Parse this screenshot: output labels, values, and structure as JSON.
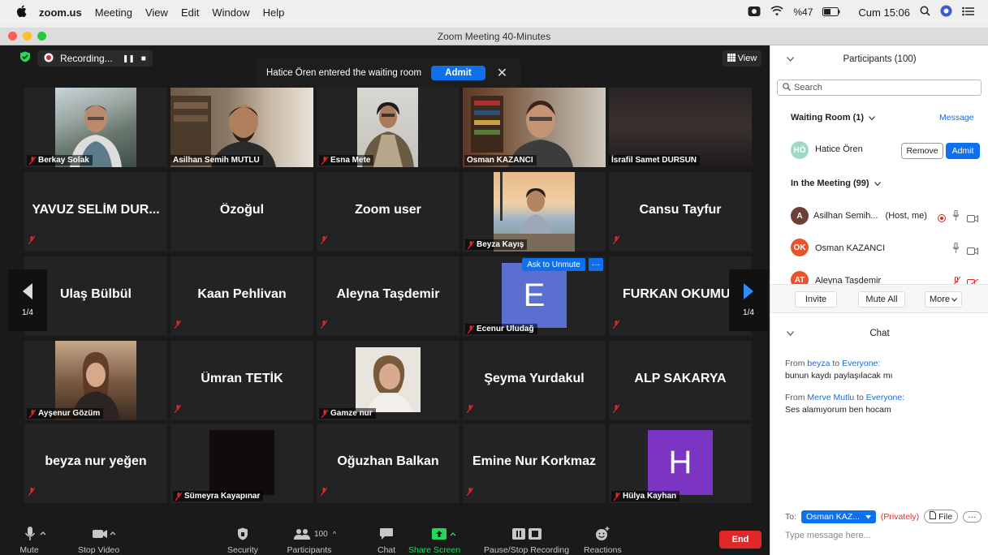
{
  "menubar": {
    "app": "zoom.us",
    "items": [
      "Meeting",
      "View",
      "Edit",
      "Window",
      "Help"
    ],
    "battery": "%47",
    "clock": "Cum 15:06"
  },
  "window": {
    "title": "Zoom Meeting  40-Minutes"
  },
  "recording": {
    "label": "Recording...",
    "pause": "❚❚",
    "stop": "■"
  },
  "view_button": {
    "label": "View"
  },
  "notification": {
    "text": "Hatice Ören entered the waiting room",
    "admit": "Admit",
    "close": "✕"
  },
  "tiles": {
    "t0": {
      "name": "Berkay Solak"
    },
    "t1": {
      "name": "Asilhan Semih MUTLU"
    },
    "t2": {
      "name": "Esna Mete"
    },
    "t3": {
      "name": "Osman KAZANCI"
    },
    "t4": {
      "name": "İsrafil Samet DURSUN"
    },
    "t5": {
      "name": "YAVUZ SELİM DUR..."
    },
    "t6": {
      "name": "Özoğul"
    },
    "t7": {
      "name": "Zoom user"
    },
    "t8": {
      "name": "Beyza Kayış"
    },
    "t9": {
      "name": "Cansu Tayfur"
    },
    "t10": {
      "name": "Ulaş Bülbül"
    },
    "t11": {
      "name": "Kaan Pehlivan"
    },
    "t12": {
      "name": "Aleyna Taşdemir"
    },
    "t13": {
      "name": "Ecenur Uludağ",
      "initial": "E"
    },
    "t14": {
      "name": "FURKAN OKUMUŞ"
    },
    "t15": {
      "name": "Ayşenur Gözüm"
    },
    "t16": {
      "name": "Ümran TETİK"
    },
    "t17": {
      "name": "Gamze nur"
    },
    "t18": {
      "name": "Şeyma Yurdakul"
    },
    "t19": {
      "name": "ALP SAKARYA"
    },
    "t20": {
      "name": "beyza nur yeğen"
    },
    "t21": {
      "name": "Sümeyra Kayapınar"
    },
    "t22": {
      "name": "Oğuzhan Balkan"
    },
    "t23": {
      "name": "Emine Nur Korkmaz"
    },
    "t24": {
      "name": "Hülya Kayhan",
      "initial": "H"
    }
  },
  "ask_unmute": {
    "label": "Ask to Unmute",
    "more": "···"
  },
  "page_nav": {
    "left": "1/4",
    "right": "1/4"
  },
  "toolbar": {
    "mute": "Mute",
    "stop_video": "Stop Video",
    "security": "Security",
    "participants": "Participants",
    "participants_count": "100",
    "chat": "Chat",
    "share_screen": "Share Screen",
    "pause_recording": "Pause/Stop Recording",
    "reactions": "Reactions",
    "end": "End"
  },
  "participants_panel": {
    "title": "Participants (100)",
    "search_placeholder": "Search",
    "waiting_room": "Waiting Room (1)",
    "message": "Message",
    "waiting_person": {
      "initials": "HÖ",
      "name": "Hatice Ören"
    },
    "remove": "Remove",
    "admit": "Admit",
    "in_meeting": "In the Meeting (99)",
    "members": [
      {
        "initials": "A",
        "name": "Asilhan Semih...",
        "role": "(Host, me)"
      },
      {
        "initials": "OK",
        "name": "Osman KAZANCI",
        "role": ""
      },
      {
        "initials": "AT",
        "name": "Aleyna Taşdemir",
        "role": ""
      }
    ],
    "invite": "Invite",
    "mute_all": "Mute All",
    "more": "More"
  },
  "chat_panel": {
    "title": "Chat",
    "messages": [
      {
        "from_word": "From",
        "from": "beyza",
        "to_word": "to",
        "to": "Everyone:",
        "text": "bunun kaydı paylaşılacak mı"
      },
      {
        "from_word": "From",
        "from": "Merve Mutlu",
        "to_word": "to",
        "to": "Everyone:",
        "text": "Ses alamıyorum ben hocam"
      }
    ],
    "to_label": "To:",
    "recipient": "Osman KAZ...",
    "privately": "(Privately)",
    "file": "File",
    "more": "···",
    "input_placeholder": "Type message here..."
  },
  "colors": {
    "accent": "#0e71eb",
    "end": "#e02828",
    "active_speaker": "#c8e071",
    "share_green": "#23d959",
    "avatar_e": "#5b6fd1",
    "avatar_h": "#7b35c2"
  }
}
